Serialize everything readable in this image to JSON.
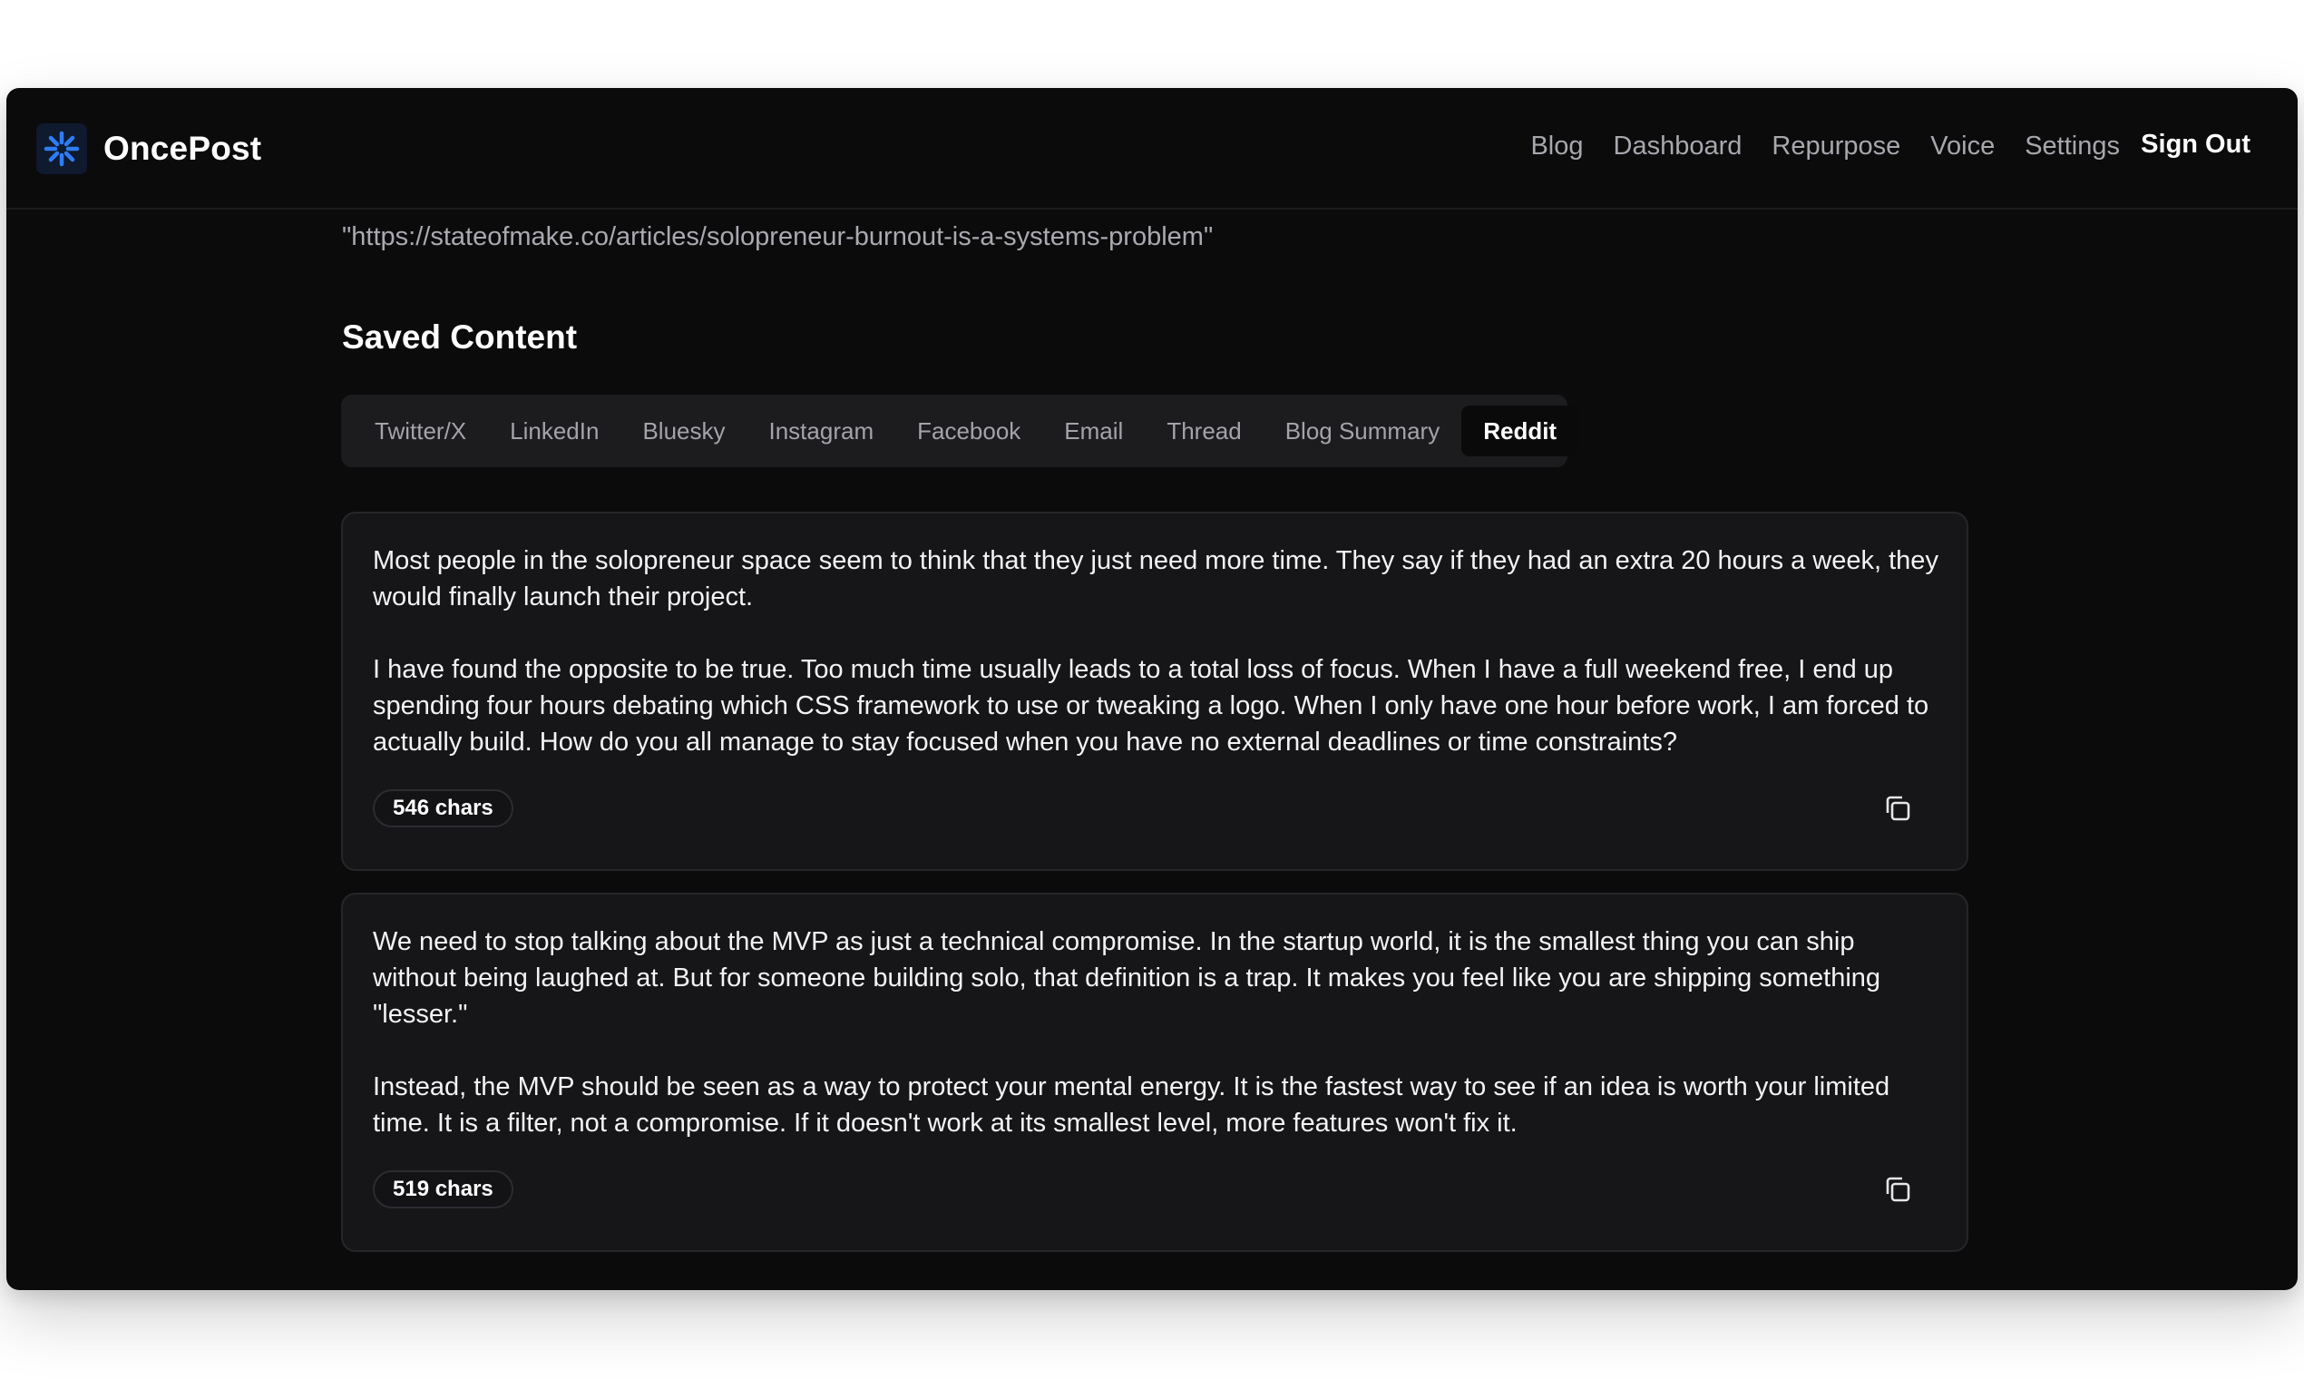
{
  "app": {
    "name": "OncePost",
    "logo_icon": "sparkle-asterisk-icon",
    "accent_color": "#2f7cf6"
  },
  "nav": {
    "items": [
      {
        "label": "Blog"
      },
      {
        "label": "Dashboard"
      },
      {
        "label": "Repurpose"
      },
      {
        "label": "Voice"
      },
      {
        "label": "Settings"
      }
    ],
    "sign_out": "Sign Out"
  },
  "source_url": "\"https://stateofmake.co/articles/solopreneur-burnout-is-a-systems-problem\"",
  "saved_content": {
    "title": "Saved Content",
    "tabs": [
      {
        "label": "Twitter/X",
        "active": false
      },
      {
        "label": "LinkedIn",
        "active": false
      },
      {
        "label": "Bluesky",
        "active": false
      },
      {
        "label": "Instagram",
        "active": false
      },
      {
        "label": "Facebook",
        "active": false
      },
      {
        "label": "Email",
        "active": false
      },
      {
        "label": "Thread",
        "active": false
      },
      {
        "label": "Blog Summary",
        "active": false
      },
      {
        "label": "Reddit",
        "active": true
      }
    ],
    "posts": [
      {
        "paragraphs": [
          "Most people in the solopreneur space seem to think that they just need more time. They say if they had an extra 20 hours a week, they would finally launch their project.",
          "I have found the opposite to be true. Too much time usually leads to a total loss of focus. When I have a full weekend free, I end up spending four hours debating which CSS framework to use or tweaking a logo. When I only have one hour before work, I am forced to actually build. How do you all manage to stay focused when you have no external deadlines or time constraints?"
        ],
        "char_count": "546 chars",
        "copy_icon": "copy-icon"
      },
      {
        "paragraphs": [
          "We need to stop talking about the MVP as just a technical compromise. In the startup world, it is the smallest thing you can ship without being laughed at. But for someone building solo, that definition is a trap. It makes you feel like you are shipping something \"lesser.\"",
          "Instead, the MVP should be seen as a way to protect your mental energy. It is the fastest way to see if an idea is worth your limited time. It is a filter, not a compromise. If it doesn't work at its smallest level, more features won't fix it."
        ],
        "char_count": "519 chars",
        "copy_icon": "copy-icon"
      }
    ]
  }
}
